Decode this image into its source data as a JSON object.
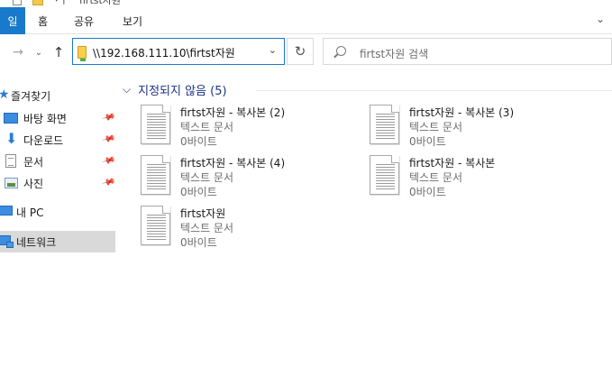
{
  "window": {
    "title": "firtst자원"
  },
  "ribbon": {
    "file_tab": "일",
    "tabs": [
      "홈",
      "공유",
      "보기"
    ]
  },
  "nav": {
    "forward_glyph": "→",
    "recent_glyph": "⌄",
    "up_glyph": "↑",
    "refresh_glyph": "↻",
    "address": "\\\\192.168.111.10\\firtst자원",
    "search_placeholder": "firtst자원 검색"
  },
  "sidebar": {
    "items": [
      {
        "label": "즐겨찾기",
        "icon": "star-icon",
        "pinned": false
      },
      {
        "label": "바탕 화면",
        "icon": "desktop-icon",
        "pinned": true
      },
      {
        "label": "다운로드",
        "icon": "download-icon",
        "pinned": true
      },
      {
        "label": "문서",
        "icon": "document-icon",
        "pinned": true
      },
      {
        "label": "사진",
        "icon": "pictures-icon",
        "pinned": true
      },
      {
        "label": "내 PC",
        "icon": "pc-icon",
        "pinned": false
      },
      {
        "label": "네트워크",
        "icon": "network-icon",
        "pinned": false,
        "selected": true
      }
    ]
  },
  "content": {
    "group": {
      "title": "지정되지 않음 (5)"
    },
    "files": [
      {
        "name": "firtst자원 - 복사본 (2)",
        "type": "텍스트 문서",
        "size": "0바이트"
      },
      {
        "name": "firtst자원 - 복사본 (3)",
        "type": "텍스트 문서",
        "size": "0바이트"
      },
      {
        "name": "firtst자원 - 복사본 (4)",
        "type": "텍스트 문서",
        "size": "0바이트"
      },
      {
        "name": "firtst자원 - 복사본",
        "type": "텍스트 문서",
        "size": "0바이트"
      },
      {
        "name": "firtst자원",
        "type": "텍스트 문서",
        "size": "0바이트"
      }
    ]
  },
  "colors": {
    "accent": "#1979ca",
    "group_title": "#1e3287",
    "selected_bg": "#d9d9d9"
  }
}
